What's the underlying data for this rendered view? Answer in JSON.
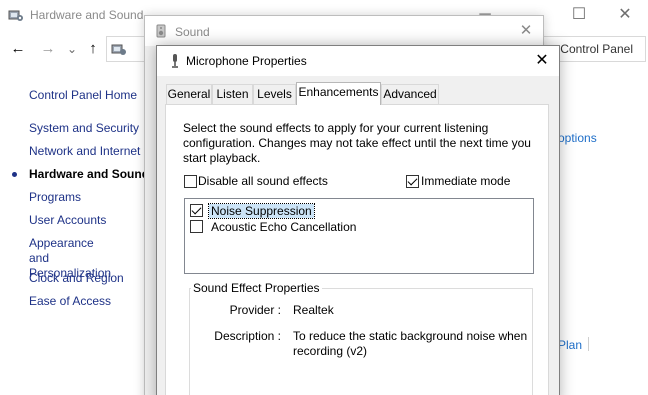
{
  "control_panel": {
    "title": "Hardware and Sound",
    "caption_buttons": {
      "minimize": "─",
      "maximize": "☐",
      "close": "✕"
    },
    "nav": {
      "back": "←",
      "forward": "→",
      "recent": "⌄",
      "up": "↑"
    },
    "address_tail": "Control Panel",
    "sidebar": [
      {
        "label": "Control Panel Home"
      },
      {
        "label": "System and Security"
      },
      {
        "label": "Network and Internet"
      },
      {
        "label": "Hardware and Sound"
      },
      {
        "label": "Programs"
      },
      {
        "label": "User Accounts"
      },
      {
        "label": "Appearance and\nPersonalization"
      },
      {
        "label": "Clock and Region"
      },
      {
        "label": "Ease of Access"
      }
    ],
    "right_fragments": {
      "options": "options",
      "plan": "Plan"
    }
  },
  "sound_window": {
    "title": "Sound",
    "close": "✕"
  },
  "dialog": {
    "title": "Microphone Properties",
    "close": "✕",
    "tabs": [
      "General",
      "Listen",
      "Levels",
      "Enhancements",
      "Advanced"
    ],
    "selected_tab": "Enhancements",
    "instructions": "Select the sound effects to apply for your current listening configuration. Changes may not take effect until the next time you start playback.",
    "disable_all": {
      "label": "Disable all sound effects",
      "checked": false
    },
    "immediate_mode": {
      "label": "Immediate mode",
      "checked": true
    },
    "effects": [
      {
        "label": "Noise Suppression",
        "checked": true,
        "selected": true
      },
      {
        "label": "Acoustic Echo Cancellation",
        "checked": false,
        "selected": false
      }
    ],
    "sound_effect_properties": {
      "title": "Sound Effect Properties",
      "provider_label": "Provider :",
      "provider_value": "Realtek",
      "description_label": "Description :",
      "description_value": "To reduce the static background noise when recording (v2)"
    }
  },
  "colors": {
    "link": "#1e3287",
    "accent_link": "#1e6ec8",
    "selection": "#cce4f7"
  }
}
